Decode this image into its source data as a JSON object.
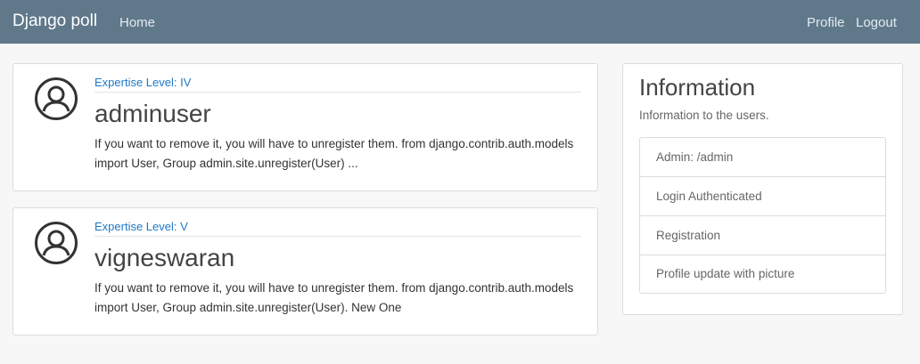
{
  "navbar": {
    "brand": "Django poll",
    "home": "Home",
    "profile": "Profile",
    "logout": "Logout"
  },
  "posts": [
    {
      "level": "Expertise Level: IV",
      "username": "adminuser",
      "body": "If you want to remove it, you will have to unregister them. from django.contrib.auth.models import User, Group admin.site.unregister(User) ..."
    },
    {
      "level": "Expertise Level: V",
      "username": "vigneswaran",
      "body": "If you want to remove it, you will have to unregister them. from django.contrib.auth.models import User, Group admin.site.unregister(User). New One"
    }
  ],
  "sidebar": {
    "title": "Information",
    "description": "Information to the users.",
    "items": [
      "Admin: /admin",
      "Login Authenticated",
      "Registration",
      "Profile update with picture"
    ]
  },
  "icons": {
    "avatar": "user-circle-icon"
  },
  "colors": {
    "navbar": "#5f788a",
    "link": "#1f77c7",
    "background": "#f7f7f7"
  }
}
